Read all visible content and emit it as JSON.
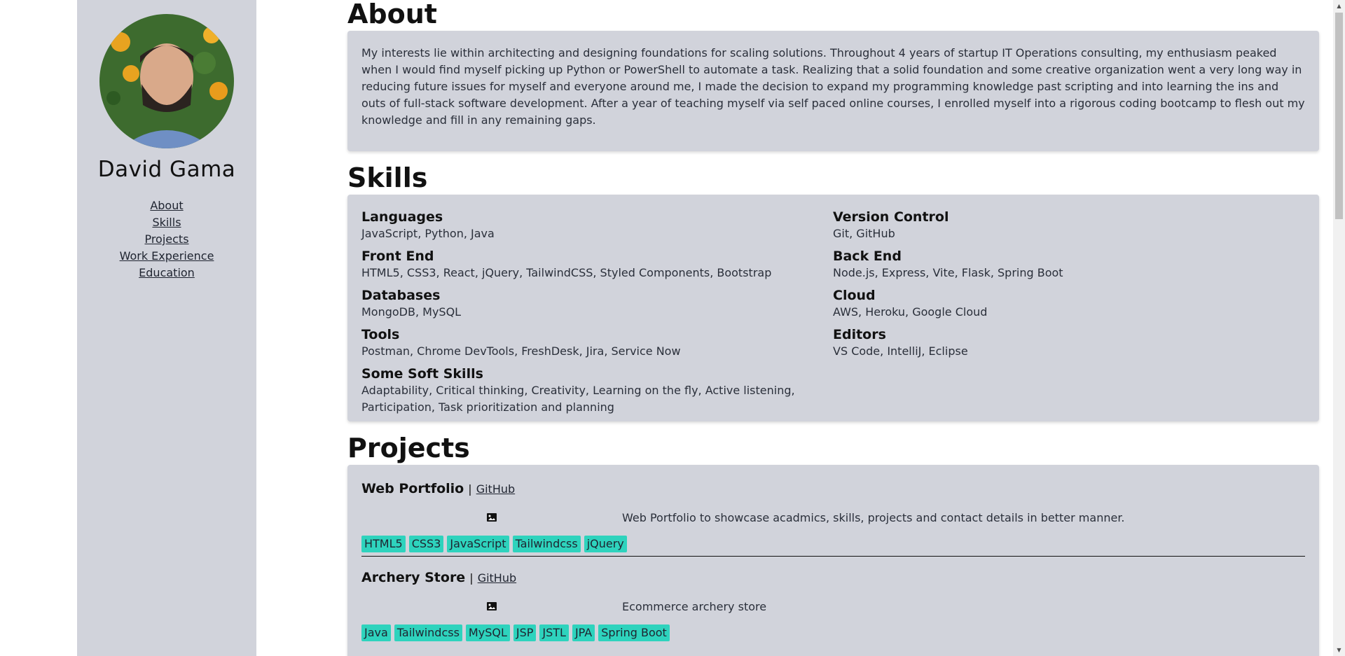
{
  "sidebar": {
    "name": "David Gama",
    "nav": [
      "About",
      "Skills",
      "Projects",
      "Work Experience",
      "Education"
    ]
  },
  "about": {
    "title": "About",
    "text": "My interests lie within architecting and designing foundations for scaling solutions. Throughout 4 years of startup IT Operations consulting, my enthusiasm peaked when I would find myself picking up Python or PowerShell to automate a task. Realizing that a solid foundation and some creative organization went a very long way in reducing future issues for myself and everyone around me, I made the decision to expand my programming knowledge past scripting and into learning the ins and outs of full-stack software development. After a year of teaching myself via self paced online courses, I enrolled myself into a rigorous coding bootcamp to flesh out my knowledge and fill in any remaining gaps."
  },
  "skills": {
    "title": "Skills",
    "left": [
      {
        "name": "Languages",
        "items": "JavaScript, Python, Java"
      },
      {
        "name": "Front End",
        "items": "HTML5, CSS3, React, jQuery, TailwindCSS, Styled Components, Bootstrap"
      },
      {
        "name": "Databases",
        "items": "MongoDB, MySQL"
      },
      {
        "name": "Tools",
        "items": "Postman, Chrome DevTools, FreshDesk, Jira, Service Now"
      },
      {
        "name": "Some Soft Skills",
        "items": "Adaptability, Critical thinking, Creativity, Learning on the fly, Active listening, Participation, Task prioritization and planning"
      }
    ],
    "right": [
      {
        "name": "Version Control",
        "items": "Git, GitHub"
      },
      {
        "name": "Back End",
        "items": "Node.js, Express, Vite, Flask, Spring Boot"
      },
      {
        "name": "Cloud",
        "items": "AWS, Heroku, Google Cloud"
      },
      {
        "name": "Editors",
        "items": "VS Code, IntelliJ, Eclipse"
      }
    ]
  },
  "projects": {
    "title": "Projects",
    "separator": "|",
    "link_label": "GitHub",
    "items": [
      {
        "name": "Web Portfolio",
        "description": "Web Portfolio to showcase acadmics, skills, projects and contact details in better manner.",
        "tags": [
          "HTML5",
          "CSS3",
          "JavaScript",
          "Tailwindcss",
          "jQuery"
        ]
      },
      {
        "name": "Archery Store",
        "description": "Ecommerce archery store",
        "tags": [
          "Java",
          "Tailwindcss",
          "MySQL",
          "JSP",
          "JSTL",
          "JPA",
          "Spring Boot"
        ]
      }
    ]
  },
  "icons": {
    "image": "image-icon"
  },
  "colors": {
    "panel": "#d1d3db",
    "tag": "#2ed3bd"
  }
}
